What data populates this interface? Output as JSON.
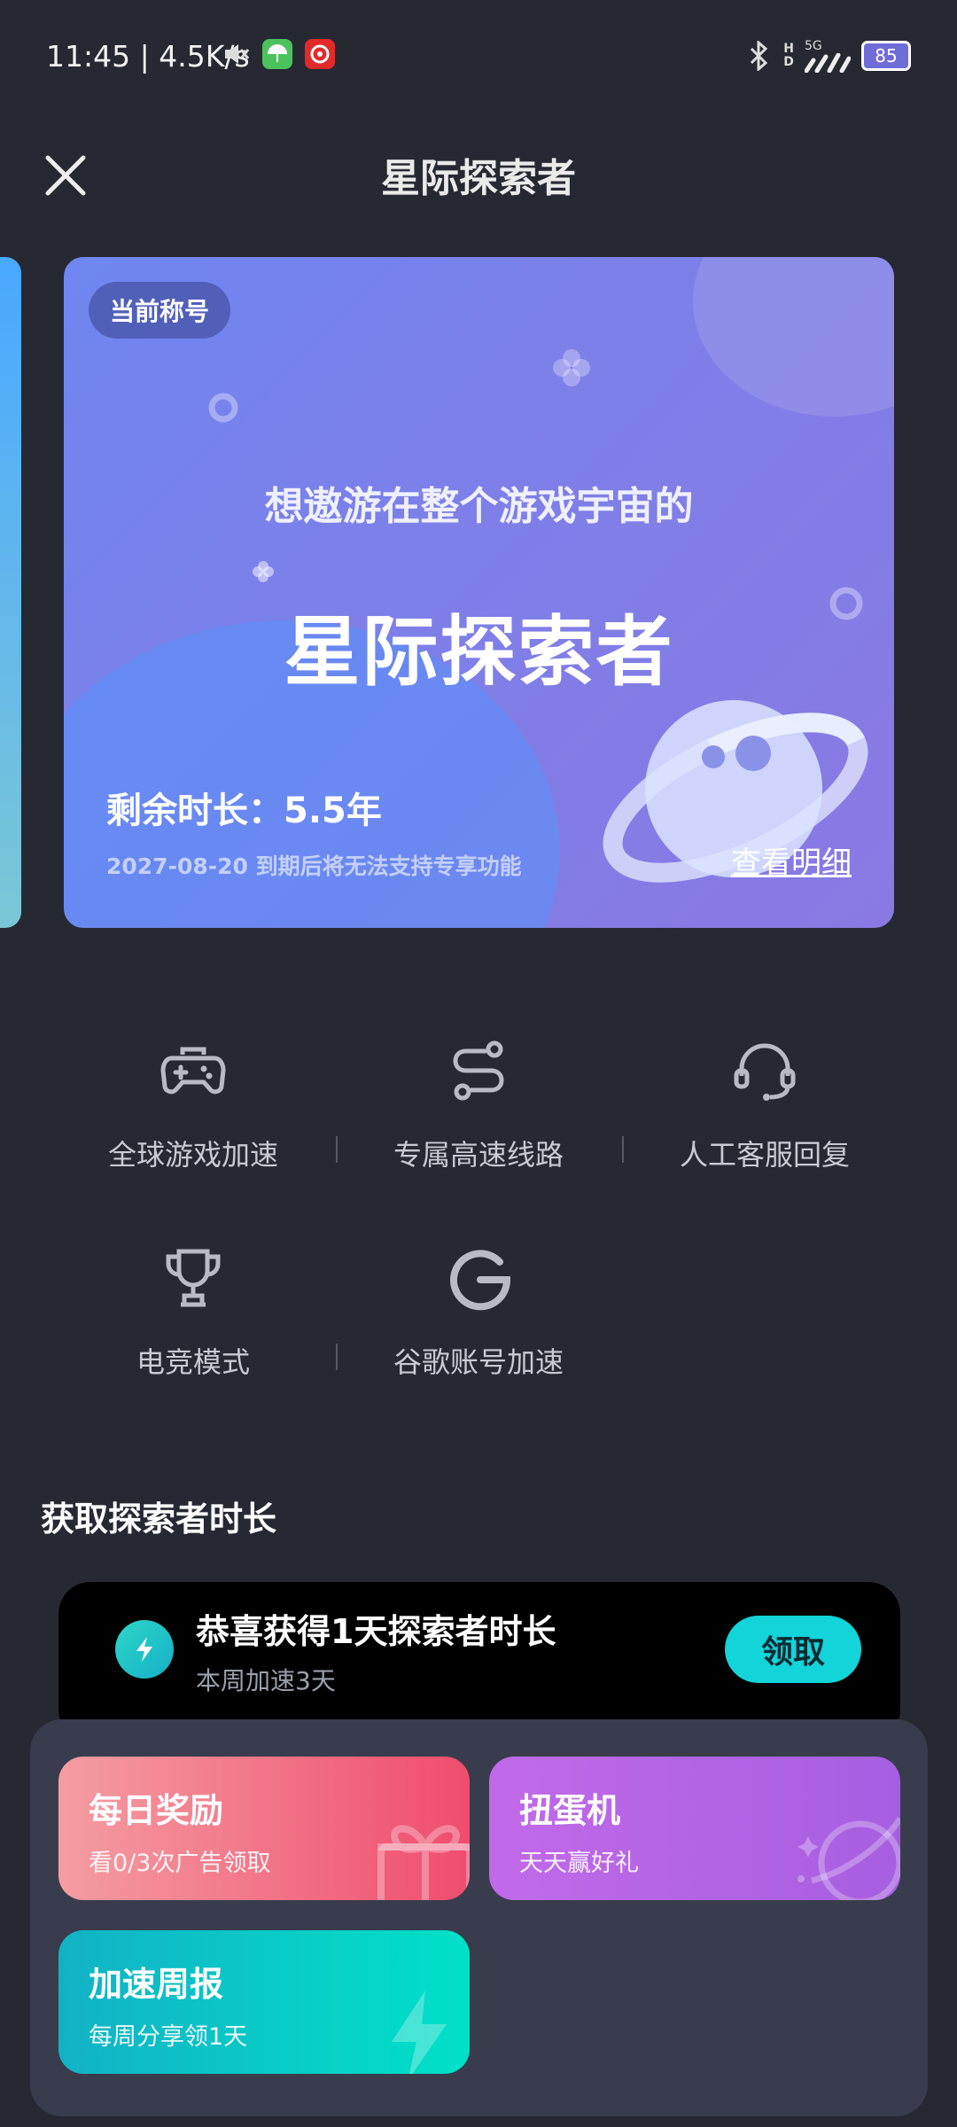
{
  "status_bar": {
    "time": "11:45",
    "speed": "4.5K/s",
    "network_label_top": "H",
    "network_label_bottom": "D",
    "network_5g": "5G",
    "battery": "85"
  },
  "header": {
    "title": "星际探索者"
  },
  "hero": {
    "badge": "当前称号",
    "subtitle": "想遨游在整个游戏宇宙的",
    "title": "星际探索者",
    "remaining": "剩余时长：5.5年",
    "expiry_note": "2027-08-20 到期后将无法支持专享功能",
    "details_link": "查看明细"
  },
  "features": [
    {
      "label": "全球游戏加速",
      "icon": "gamepad-icon"
    },
    {
      "label": "专属高速线路",
      "icon": "route-icon"
    },
    {
      "label": "人工客服回复",
      "icon": "headset-icon"
    },
    {
      "label": "电竞模式",
      "icon": "trophy-icon"
    },
    {
      "label": "谷歌账号加速",
      "icon": "google-icon"
    }
  ],
  "section": {
    "title": "获取探索者时长"
  },
  "reward": {
    "title": "恭喜获得1天探索者时长",
    "subtitle": "本周加速3天",
    "button": "领取"
  },
  "tiles": [
    {
      "title": "每日奖励",
      "subtitle": "看0/3次广告领取",
      "icon": "gift-icon"
    },
    {
      "title": "扭蛋机",
      "subtitle": "天天赢好礼",
      "icon": "planet-icon"
    },
    {
      "title": "加速周报",
      "subtitle": "每周分享领1天",
      "icon": "bolt-icon"
    }
  ],
  "colors": {
    "background": "#262932",
    "accent_cyan": "#12d4d9",
    "hero_blue": "#6f86f0",
    "daily_red": "#ef4d6e",
    "gacha_purple": "#a55fe0",
    "weekly_teal": "#00e1c8"
  }
}
